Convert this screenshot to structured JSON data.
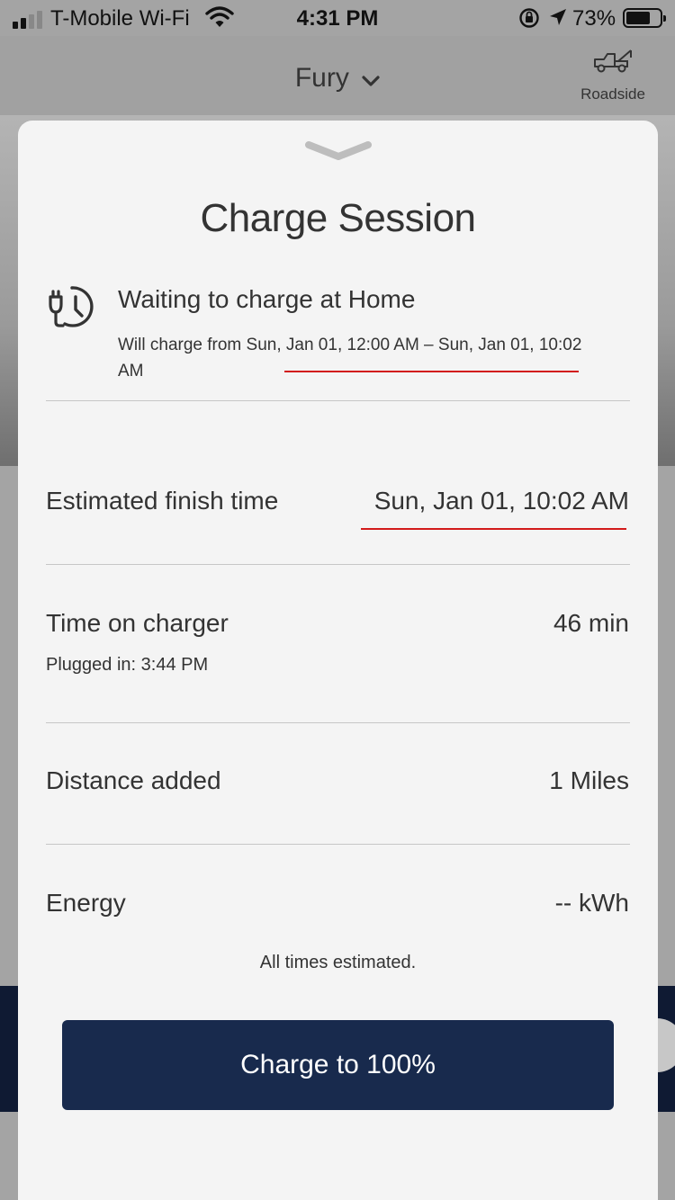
{
  "status_bar": {
    "carrier": "T-Mobile Wi-Fi",
    "time": "4:31 PM",
    "battery": "73%",
    "battery_level": 0.73
  },
  "header": {
    "vehicle_name": "Fury",
    "roadside_label": "Roadside"
  },
  "sheet": {
    "title": "Charge Session",
    "status_title": "Waiting to charge at Home",
    "status_desc": "Will charge from Sun, Jan 01, 12:00 AM – Sun, Jan 01, 10:02 AM",
    "rows": [
      {
        "label": "Estimated finish time",
        "value": "Sun, Jan 01, 10:02 AM"
      },
      {
        "label": "Time on charger",
        "value": "46 min",
        "sub": "Plugged in: 3:44 PM"
      },
      {
        "label": "Distance added",
        "value": "1 Miles"
      },
      {
        "label": "Energy",
        "value": "-- kWh"
      }
    ],
    "note": "All times estimated.",
    "cta_label": "Charge to 100%"
  },
  "colors": {
    "sheet_bg": "#f4f4f4",
    "cta_bg": "#182a4d",
    "highlight_underline": "#d21a1a"
  }
}
